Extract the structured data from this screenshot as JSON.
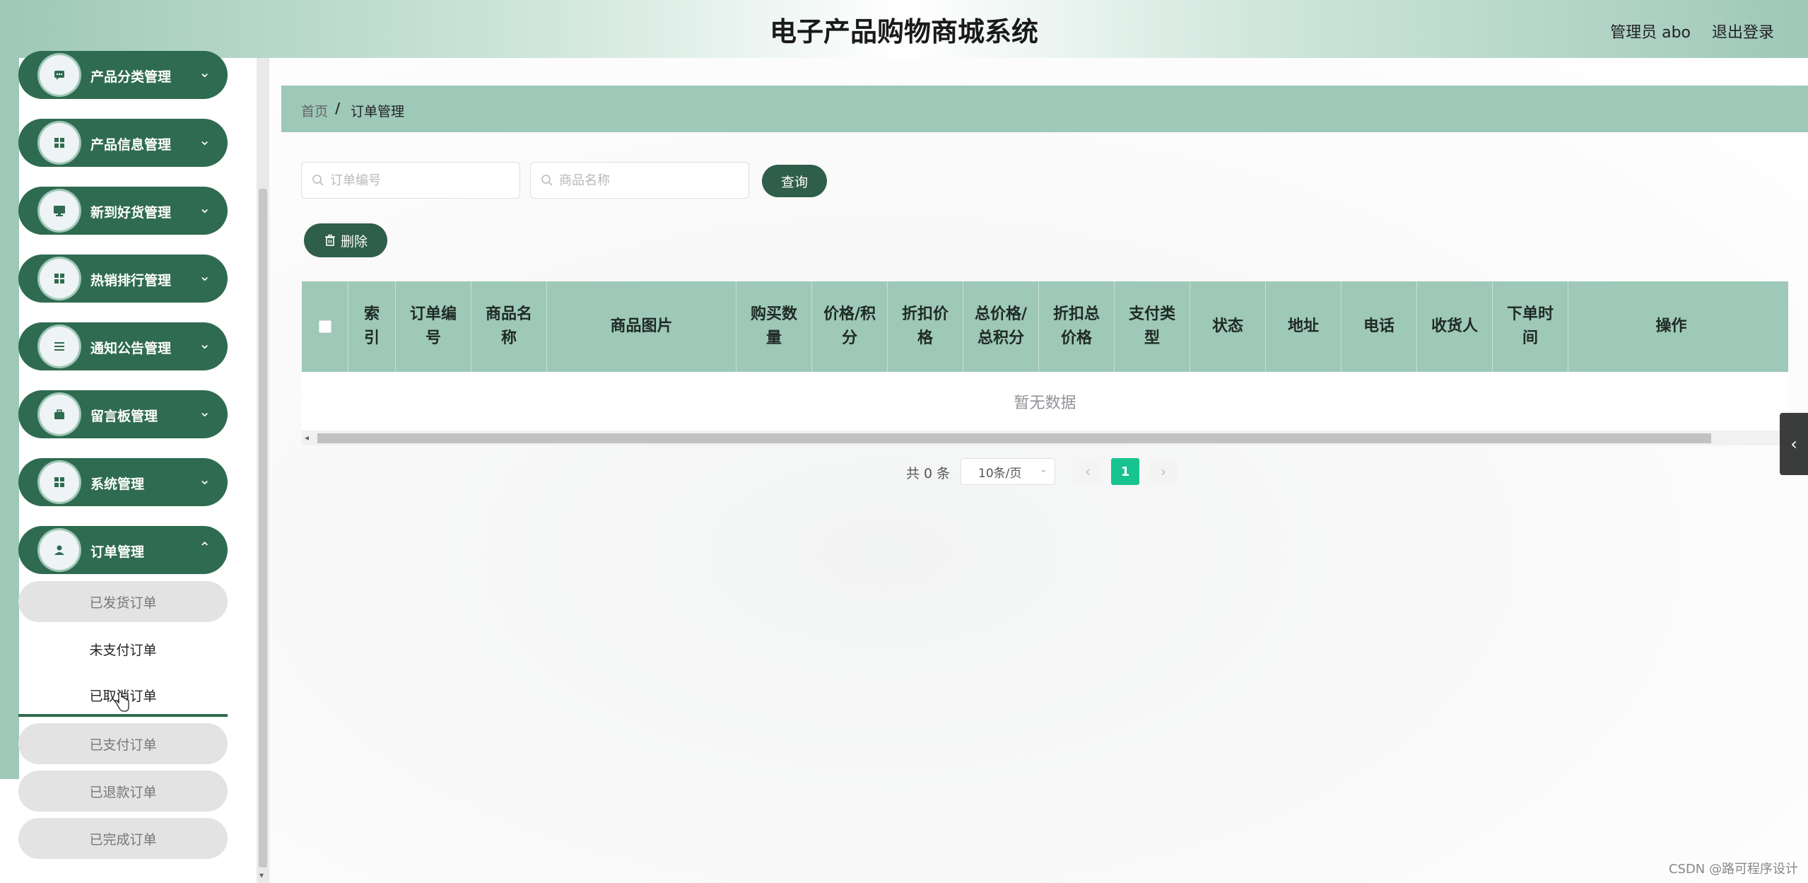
{
  "header": {
    "title": "电子产品购物商城系统",
    "user": "管理员 abo",
    "logout": "退出登录"
  },
  "sidebar": {
    "items": [
      {
        "label": "产品分类管理",
        "icon": "chat-icon"
      },
      {
        "label": "产品信息管理",
        "icon": "grid-icon"
      },
      {
        "label": "新到好货管理",
        "icon": "monitor-icon"
      },
      {
        "label": "热销排行管理",
        "icon": "grid-icon"
      },
      {
        "label": "通知公告管理",
        "icon": "list-icon"
      },
      {
        "label": "留言板管理",
        "icon": "briefcase-icon"
      },
      {
        "label": "系统管理",
        "icon": "grid-icon"
      },
      {
        "label": "订单管理",
        "icon": "user-icon"
      }
    ],
    "sub_items": [
      {
        "label": "已发货订单"
      },
      {
        "label": "未支付订单"
      },
      {
        "label": "已取消订单"
      },
      {
        "label": "已支付订单"
      },
      {
        "label": "已退款订单"
      },
      {
        "label": "已完成订单"
      }
    ]
  },
  "breadcrumb": {
    "home": "首页",
    "separator": "/",
    "current": "订单管理"
  },
  "search": {
    "order_no_placeholder": "订单编号",
    "product_name_placeholder": "商品名称",
    "query_label": "查询",
    "delete_label": "删除"
  },
  "table": {
    "columns": [
      {
        "label": "索\n引"
      },
      {
        "label": "订单编\n号"
      },
      {
        "label": "商品名\n称"
      },
      {
        "label": "商品图片"
      },
      {
        "label": "购买数\n量"
      },
      {
        "label": "价格/积\n分"
      },
      {
        "label": "折扣价\n格"
      },
      {
        "label": "总价格/\n总积分"
      },
      {
        "label": "折扣总\n价格"
      },
      {
        "label": "支付类\n型"
      },
      {
        "label": "状态"
      },
      {
        "label": "地址"
      },
      {
        "label": "电话"
      },
      {
        "label": "收货人"
      },
      {
        "label": "下单时\n间"
      },
      {
        "label": "操作"
      }
    ],
    "empty_text": "暂无数据"
  },
  "pagination": {
    "total": "共 0 条",
    "page_size": "10条/页",
    "current_page": "1"
  },
  "watermark": "CSDN @路可程序设计",
  "colors": {
    "accent_dark": "#2f6b50",
    "accent_light": "#9ec8b8",
    "page_active": "#17c38f"
  }
}
